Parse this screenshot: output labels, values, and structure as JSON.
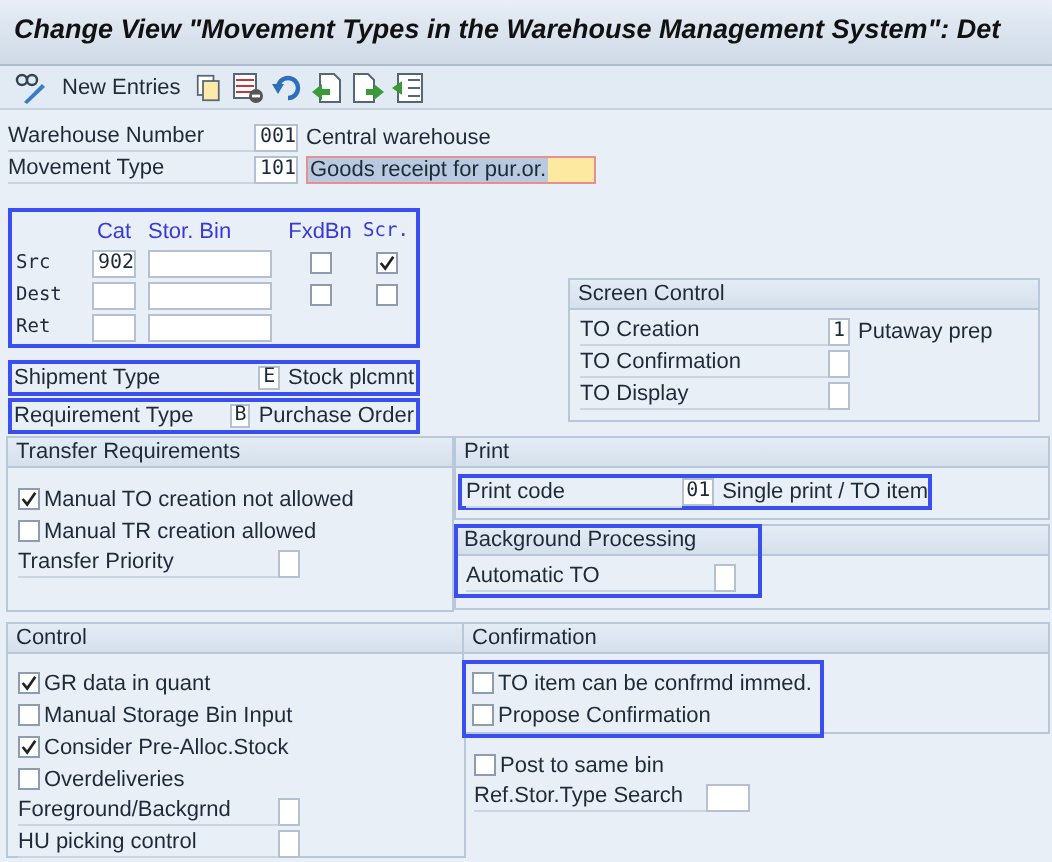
{
  "title": "Change View \"Movement Types in the Warehouse Management System\": Det",
  "toolbar": {
    "new_entries": "New Entries"
  },
  "header": [
    {
      "label": "Warehouse Number",
      "value": "001",
      "description": "Central warehouse",
      "kind": "text"
    },
    {
      "label": "Movement Type",
      "value": "101",
      "description": "Goods receipt for pur.or.",
      "kind": "field"
    }
  ],
  "bins": {
    "highlighted": true,
    "columns": [
      "Cat",
      "Stor. Bin",
      "FxdBn",
      "Scr."
    ],
    "rows": [
      {
        "label": "Src",
        "cat": "902",
        "fixed_bin": false,
        "screen": true
      },
      {
        "label": "Dest",
        "fixed_bin": false,
        "screen": false
      },
      {
        "label": "Ret"
      }
    ]
  },
  "shipment_type": {
    "highlighted": true,
    "label": "Shipment Type",
    "value": "E",
    "description": "Stock plcmnt"
  },
  "requirement_type": {
    "highlighted": true,
    "label": "Requirement Type",
    "value": "B",
    "description": "Purchase Order"
  },
  "screen_control": {
    "title": "Screen Control",
    "rows": [
      {
        "label": "TO Creation",
        "value": "1",
        "description": "Putaway prep"
      },
      {
        "label": "TO Confirmation"
      },
      {
        "label": "TO Display"
      }
    ]
  },
  "transfer_requirements": {
    "title": "Transfer Requirements",
    "items": [
      {
        "kind": "checkbox",
        "label": "Manual TO creation not allowed",
        "checked": true
      },
      {
        "kind": "checkbox",
        "label": "Manual TR creation allowed",
        "checked": false
      },
      {
        "kind": "field",
        "label": "Transfer Priority"
      }
    ]
  },
  "print": {
    "title": "Print",
    "highlighted": true,
    "label": "Print code",
    "value": "01",
    "description": "Single print / TO item"
  },
  "background_processing": {
    "title": "Background Processing",
    "highlighted": true,
    "items": [
      {
        "kind": "field",
        "label": "Automatic TO"
      }
    ]
  },
  "control": {
    "title": "Control",
    "items": [
      {
        "kind": "checkbox",
        "label": "GR data in quant",
        "checked": true
      },
      {
        "kind": "checkbox",
        "label": "Manual Storage Bin Input",
        "checked": false
      },
      {
        "kind": "checkbox",
        "label": "Consider Pre-Alloc.Stock",
        "checked": true
      },
      {
        "kind": "checkbox",
        "label": "Overdeliveries",
        "checked": false
      },
      {
        "kind": "field",
        "label": "Foreground/Backgrnd"
      },
      {
        "kind": "field",
        "label": "HU picking control"
      }
    ]
  },
  "confirmation": {
    "title": "Confirmation",
    "highlighted": true,
    "items": [
      {
        "kind": "checkbox",
        "label": "TO item can be confrmd immed.",
        "checked": false
      },
      {
        "kind": "checkbox",
        "label": "Propose Confirmation",
        "checked": false
      }
    ]
  },
  "other": {
    "items": [
      {
        "kind": "checkbox",
        "label": "Post to same bin",
        "checked": false
      },
      {
        "kind": "field",
        "label": "Ref.Stor.Type Search"
      }
    ]
  }
}
